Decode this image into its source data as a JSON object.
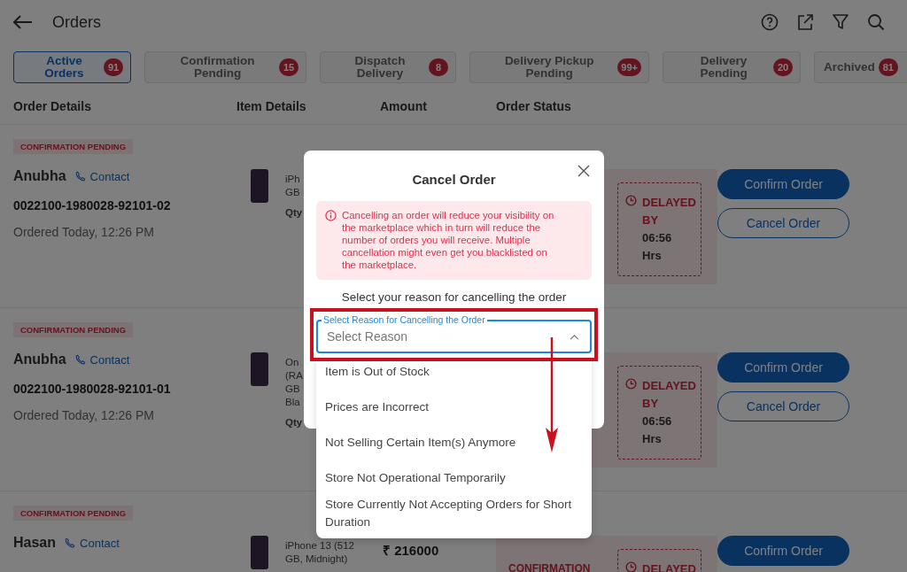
{
  "header": {
    "title": "Orders"
  },
  "tabs": [
    {
      "label": "Active Orders",
      "count": "91",
      "selected": true
    },
    {
      "label": "Confirmation Pending",
      "count": "15",
      "selected": false
    },
    {
      "label": "Dispatch Delivery",
      "count": "8",
      "selected": false
    },
    {
      "label": "Delivery Pickup Pending",
      "count": "99+",
      "selected": false
    },
    {
      "label": "Delivery Pending",
      "count": "20",
      "selected": false
    },
    {
      "label": "Archived",
      "count": "81",
      "selected": false
    }
  ],
  "columns": [
    "Order Details",
    "Item Details",
    "Amount",
    "Order Status"
  ],
  "orders": [
    {
      "status_tag": "CONFIRMATION PENDING",
      "customer": "Anubha",
      "contact": "Contact",
      "order_id": "0022100-1980028-92101-02",
      "ordered": "Ordered Today, 12:26 PM",
      "item_lines": [
        "iPh",
        "GB"
      ],
      "qty": "Qty",
      "delay_label": "DELAYED BY",
      "delay_time": "06:56 Hrs",
      "actions": [
        {
          "label": "Confirm Order",
          "kind": "primary"
        },
        {
          "label": "Cancel Order",
          "kind": "outline"
        }
      ]
    },
    {
      "status_tag": "CONFIRMATION PENDING",
      "customer": "Anubha",
      "contact": "Contact",
      "order_id": "0022100-1980028-92101-01",
      "ordered": "Ordered Today, 12:26 PM",
      "item_lines": [
        "On",
        "(RA",
        "GB",
        "Bla"
      ],
      "qty": "Qty",
      "delay_label": "DELAYED BY",
      "delay_time": "06:56 Hrs",
      "actions": [
        {
          "label": "Confirm Order",
          "kind": "primary"
        },
        {
          "label": "Cancel Order",
          "kind": "outline"
        }
      ]
    },
    {
      "status_tag": "CONFIRMATION PENDING",
      "customer": "Hasan",
      "contact": "Contact",
      "item_lines": [
        "iPhone 13 (512",
        "GB, Midnight)"
      ],
      "amount": "₹ 216000",
      "status_label": "CONFIRMATION",
      "delay_label": "DELAYED",
      "actions": [
        {
          "label": "Confirm Order",
          "kind": "primary"
        }
      ]
    }
  ],
  "dialog": {
    "title": "Cancel Order",
    "warning": "Cancelling an order will reduce your visibility on the marketplace which in turn will reduce the number of orders you will receive. Multiple cancellation might even get you blacklisted on the marketplace.",
    "prompt": "Select your reason for cancelling the order",
    "select": {
      "label": "Select Reason for Cancelling the Order",
      "placeholder": "Select Reason",
      "expanded": true
    },
    "options": [
      "Item is Out of Stock",
      "Prices are Incorrect",
      "Not Selling Certain Item(s) Anymore",
      "Store Not Operational Temporarily",
      "Store Currently Not Accepting Orders for Short Duration"
    ]
  }
}
